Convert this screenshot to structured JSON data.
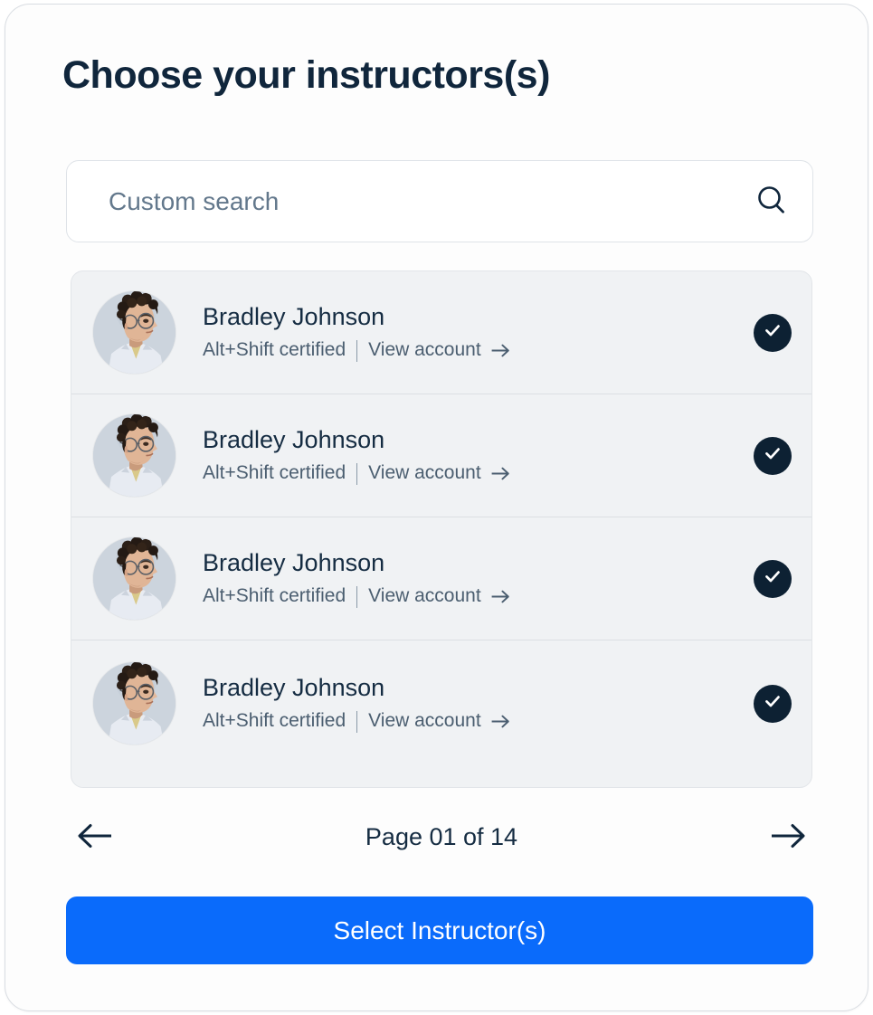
{
  "page": {
    "title": "Choose your instructors(s)",
    "accent_color": "#0a6bfb",
    "dark_color": "#10263c",
    "list_bg_color": "#f0f2f4"
  },
  "search": {
    "placeholder": "Custom search",
    "value": "",
    "icon": "search-icon"
  },
  "instructors": [
    {
      "name": "Bradley Johnson",
      "certification": "Alt+Shift certified",
      "link_label": "View account",
      "link_arrow": "→",
      "selected": true,
      "avatar_alt": "Bradley Johnson portrait"
    },
    {
      "name": "Bradley Johnson",
      "certification": "Alt+Shift certified",
      "link_label": "View account",
      "link_arrow": "→",
      "selected": true,
      "avatar_alt": "Bradley Johnson portrait"
    },
    {
      "name": "Bradley Johnson",
      "certification": "Alt+Shift certified",
      "link_label": "View account",
      "link_arrow": "→",
      "selected": true,
      "avatar_alt": "Bradley Johnson portrait"
    },
    {
      "name": "Bradley Johnson",
      "certification": "Alt+Shift certified",
      "link_label": "View account",
      "link_arrow": "→",
      "selected": true,
      "avatar_alt": "Bradley Johnson portrait"
    }
  ],
  "pagination": {
    "prev_icon": "arrow-left-icon",
    "next_icon": "arrow-right-icon",
    "label": "Page 01 of 14",
    "current_page": "01",
    "total_pages": "14"
  },
  "submit": {
    "label": "Select Instructor(s)"
  }
}
